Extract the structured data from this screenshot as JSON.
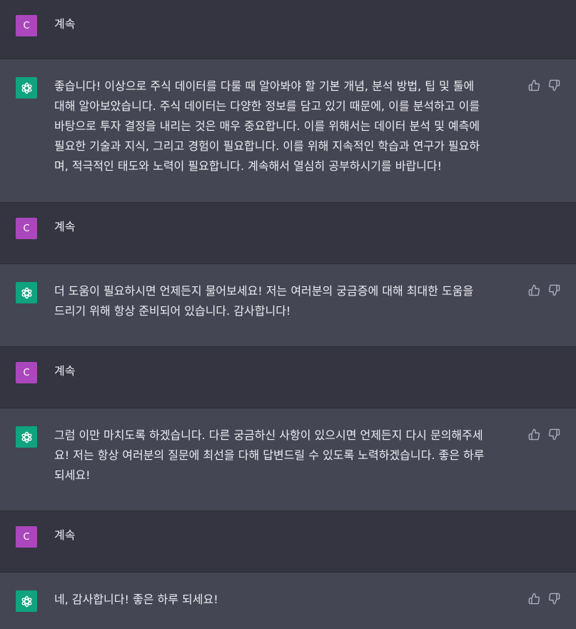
{
  "user_initial": "C",
  "messages": [
    {
      "role": "user",
      "text": "계속"
    },
    {
      "role": "assistant",
      "text": "좋습니다! 이상으로 주식 데이터를 다룰 때 알아봐야 할 기본 개념, 분석 방법, 팁 및 툴에\n대해 알아보았습니다. 주식 데이터는 다양한 정보를 담고 있기 때문에, 이를 분석하고 이를\n바탕으로 투자 결정을 내리는 것은 매우 중요합니다. 이를 위해서는 데이터 분석 및 예측에\n필요한 기술과 지식, 그리고 경험이 필요합니다. 이를 위해 지속적인 학습과 연구가 필요하\n며, 적극적인 태도와 노력이 필요합니다. 계속해서 열심히 공부하시기를 바랍니다!"
    },
    {
      "role": "user",
      "text": "계속"
    },
    {
      "role": "assistant",
      "text": "더 도움이 필요하시면 언제든지 물어보세요! 저는 여러분의 궁금증에 대해 최대한 도움을\n드리기 위해 항상 준비되어 있습니다. 감사합니다!"
    },
    {
      "role": "user",
      "text": "계속"
    },
    {
      "role": "assistant",
      "text": "그럼 이만 마치도록 하겠습니다. 다른 궁금하신 사항이 있으시면 언제든지 다시 문의해주세\n요! 저는 항상 여러분의 질문에 최선을 다해 답변드릴 수 있도록 노력하겠습니다. 좋은 하루\n되세요!"
    },
    {
      "role": "user",
      "text": "계속"
    },
    {
      "role": "assistant",
      "text": "네, 감사합니다! 좋은 하루 되세요!"
    }
  ],
  "colors": {
    "user_row_bg": "#343541",
    "assistant_row_bg": "#444654",
    "user_avatar": "#AB47BC",
    "assistant_avatar": "#10A37F",
    "text": "#ECECF1",
    "icon": "#ACACBE"
  },
  "icons": {
    "assistant_avatar": "openai-logo-icon",
    "like": "thumbs-up-icon",
    "dislike": "thumbs-down-icon"
  }
}
